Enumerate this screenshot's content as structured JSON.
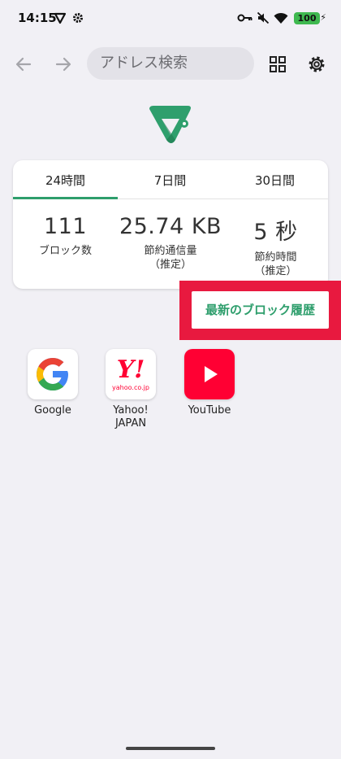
{
  "status_bar": {
    "time": "14:15",
    "battery": "100"
  },
  "toolbar": {
    "back_icon": "arrow-left-icon",
    "forward_icon": "arrow-right-icon",
    "address_placeholder": "アドレス検索",
    "tabs_icon": "grid-icon",
    "settings_icon": "gear-icon"
  },
  "stats": {
    "tabs": [
      {
        "label": "24時間",
        "selected": true
      },
      {
        "label": "7日間",
        "selected": false
      },
      {
        "label": "30日間",
        "selected": false
      }
    ],
    "items": [
      {
        "value": "111",
        "label": "ブロック数",
        "sublabel": ""
      },
      {
        "value": "25.74 KB",
        "label": "節約通信量",
        "sublabel": "（推定）"
      },
      {
        "value": "5 秒",
        "label": "節約時間",
        "sublabel": "（推定）"
      }
    ]
  },
  "history_button": {
    "label": "最新のブロック履歴"
  },
  "shortcuts": [
    {
      "label": "Google",
      "icon": "google-icon"
    },
    {
      "label": "Yahoo!\nJAPAN",
      "icon": "yahoo-japan-icon",
      "icon_text": "Y!",
      "icon_subtext": "yahoo.co.jp"
    },
    {
      "label": "YouTube",
      "icon": "youtube-icon"
    }
  ],
  "colors": {
    "accent": "#2e9e6c",
    "highlight": "#e8193f",
    "background": "#f1f0f5"
  }
}
